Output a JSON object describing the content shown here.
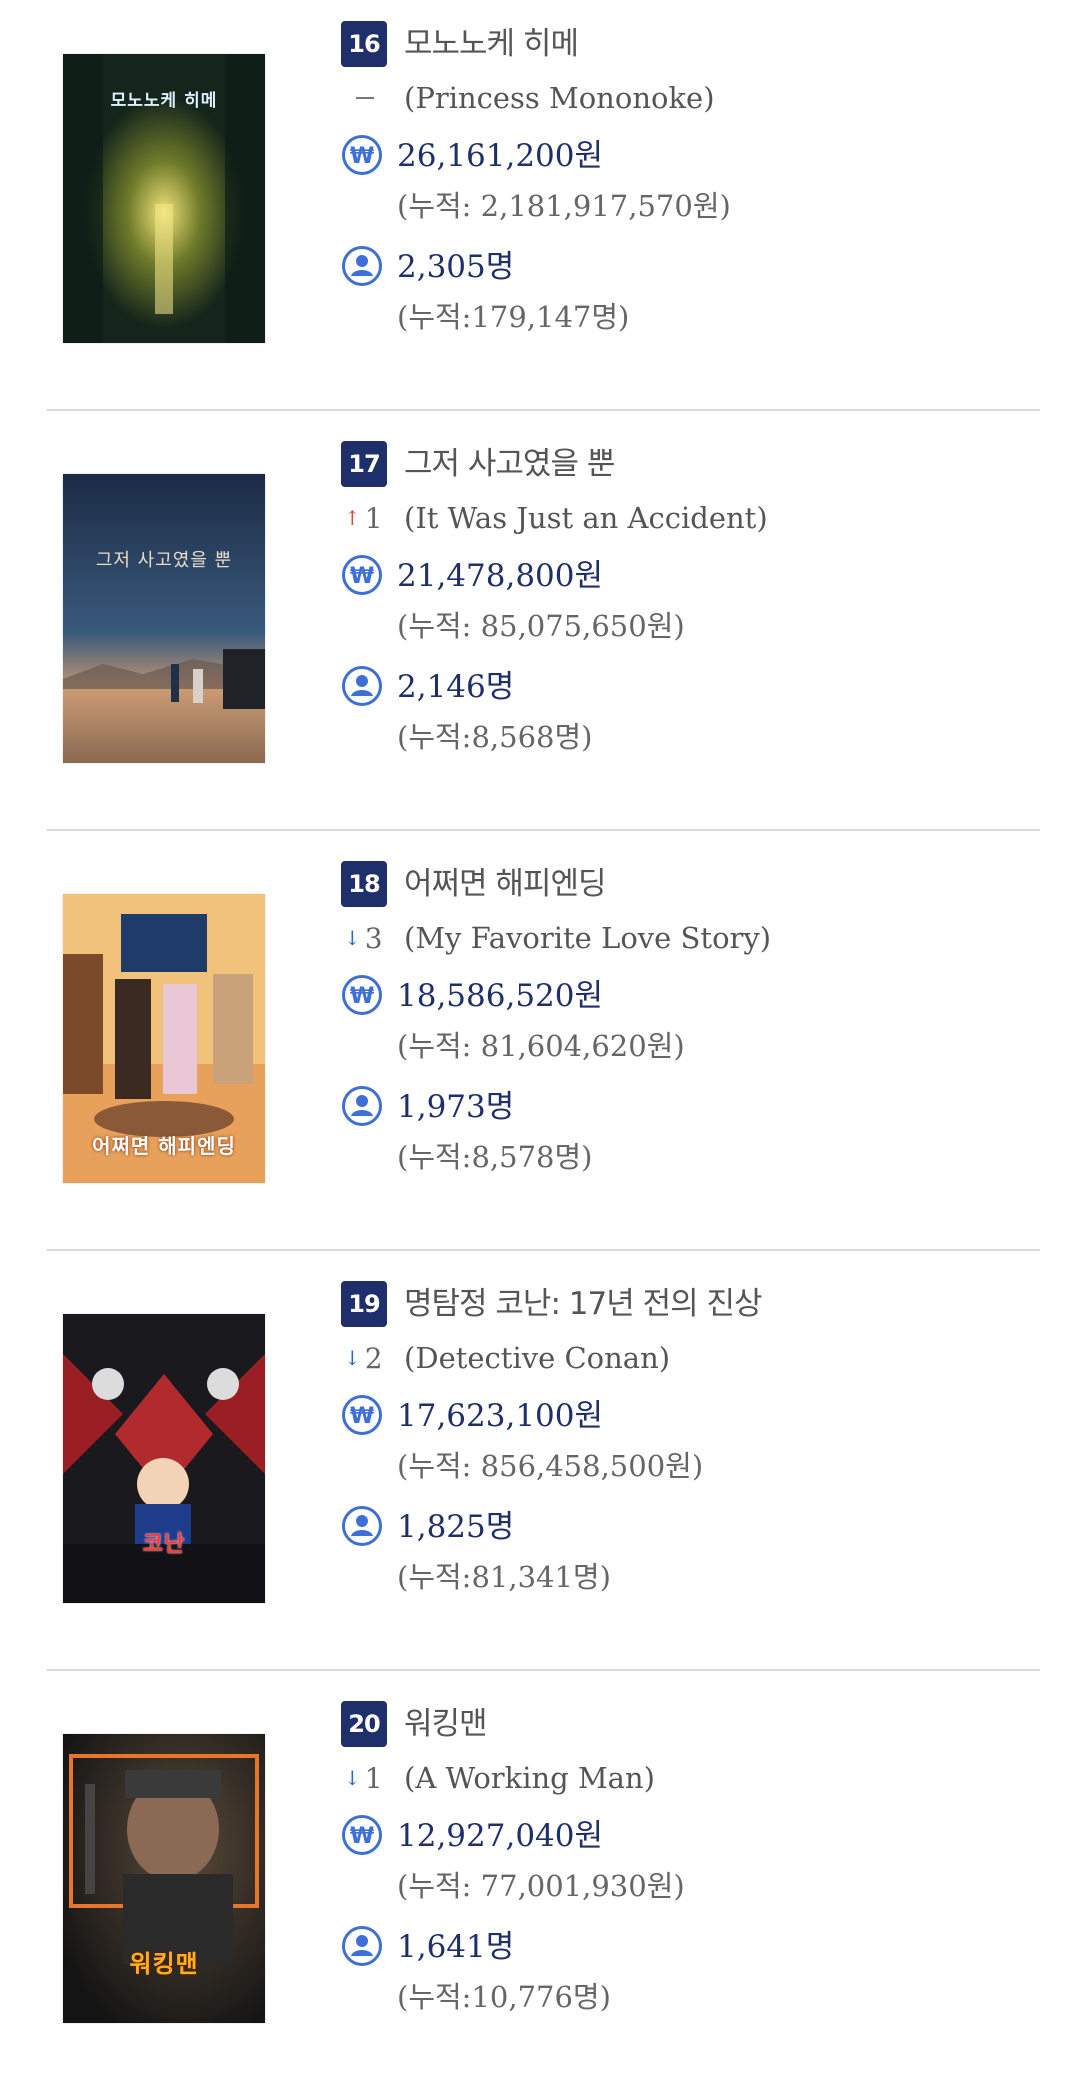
{
  "movies": [
    {
      "rank": "16",
      "title_ko": "모노노케 히메",
      "title_en": "(Princess Mononoke)",
      "rank_change": {
        "direction": "none",
        "amount": ""
      },
      "sales": "26,161,200원",
      "sales_total": "(누적: 2,181,917,570원)",
      "audience": "2,305명",
      "audience_total": "(누적:179,147명)",
      "poster_text": "모노노케 히메"
    },
    {
      "rank": "17",
      "title_ko": "그저 사고였을 뿐",
      "title_en": "(It Was Just an Accident)",
      "rank_change": {
        "direction": "up",
        "amount": "1"
      },
      "sales": "21,478,800원",
      "sales_total": "(누적: 85,075,650원)",
      "audience": "2,146명",
      "audience_total": "(누적:8,568명)",
      "poster_text": "그저 사고였을 뿐"
    },
    {
      "rank": "18",
      "title_ko": "어쩌면 해피엔딩",
      "title_en": "(My Favorite Love Story)",
      "rank_change": {
        "direction": "down",
        "amount": "3"
      },
      "sales": "18,586,520원",
      "sales_total": "(누적: 81,604,620원)",
      "audience": "1,973명",
      "audience_total": "(누적:8,578명)",
      "poster_text": "어쩌면 해피엔딩"
    },
    {
      "rank": "19",
      "title_ko": "명탐정 코난: 17년 전의 진상",
      "title_en": "(Detective Conan)",
      "rank_change": {
        "direction": "down",
        "amount": "2"
      },
      "sales": "17,623,100원",
      "sales_total": "(누적: 856,458,500원)",
      "audience": "1,825명",
      "audience_total": "(누적:81,341명)",
      "poster_text": "코난"
    },
    {
      "rank": "20",
      "title_ko": "워킹맨",
      "title_en": "(A Working Man)",
      "rank_change": {
        "direction": "down",
        "amount": "1"
      },
      "sales": "12,927,040원",
      "sales_total": "(누적: 77,001,930원)",
      "audience": "1,641명",
      "audience_total": "(누적:10,776명)",
      "poster_text": "워킹맨"
    }
  ],
  "colors": {
    "badge": "#1f2f6b",
    "value_text": "#1f2f6b",
    "icon_blue": "#3d6fd6",
    "up_arrow": "#e0453a",
    "down_arrow": "#2d66c6"
  },
  "icons": {
    "sales": "won-icon",
    "audience": "person-icon",
    "up": "arrow-up-icon",
    "down": "arrow-down-icon"
  }
}
